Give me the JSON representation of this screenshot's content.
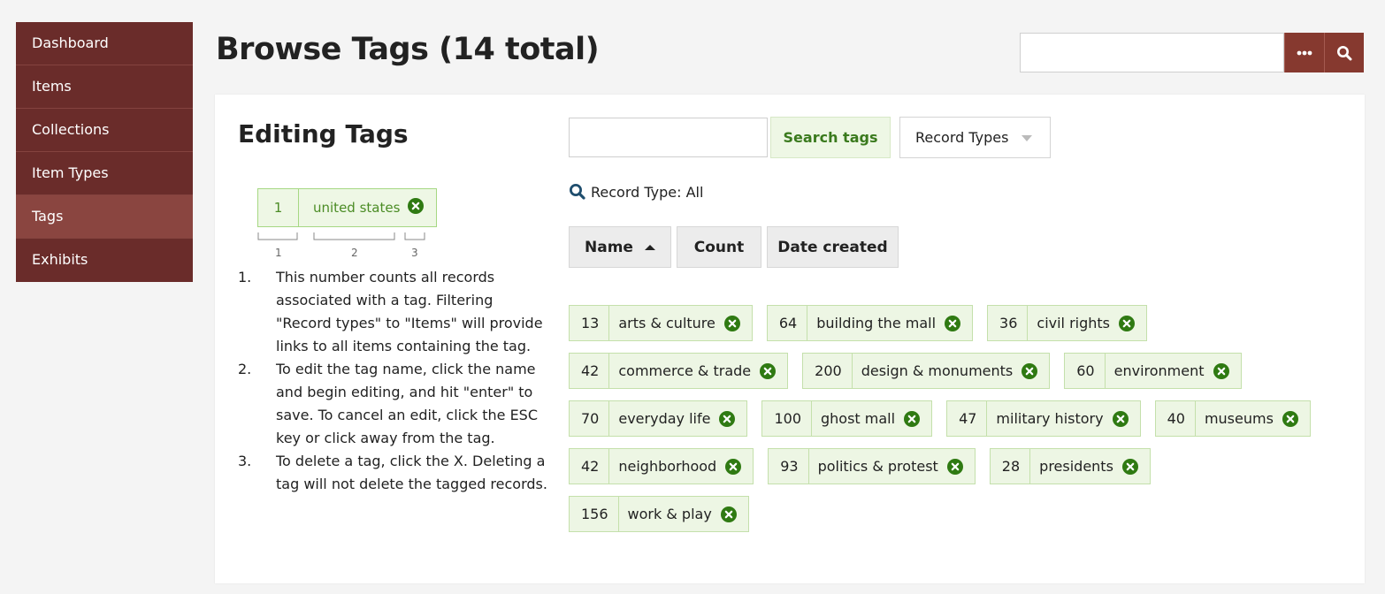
{
  "sidebar": {
    "items": [
      {
        "label": "Dashboard"
      },
      {
        "label": "Items"
      },
      {
        "label": "Collections"
      },
      {
        "label": "Item Types"
      },
      {
        "label": "Tags",
        "active": true
      },
      {
        "label": "Exhibits"
      }
    ]
  },
  "header": {
    "title": "Browse Tags (14 total)",
    "search": {
      "value": "",
      "placeholder": ""
    }
  },
  "help": {
    "title": "Editing Tags",
    "demo_tag": {
      "count": "1",
      "name": "united states"
    },
    "legend": [
      "1",
      "2",
      "3"
    ],
    "steps": [
      {
        "num": "1.",
        "text": "This number counts all records associated with a tag. Filtering \"Record types\" to \"Items\" will provide links to all items containing the tag."
      },
      {
        "num": "2.",
        "text": "To edit the tag name, click the name and begin editing, and hit \"enter\" to save. To cancel an edit, click the ESC key or click away from the tag."
      },
      {
        "num": "3.",
        "text": "To delete a tag, click the X. Deleting a tag will not delete the tagged records."
      }
    ]
  },
  "tag_search": {
    "value": "",
    "button_label": "Search tags",
    "record_types_label": "Record Types",
    "filter_text": "Record Type: All"
  },
  "sort": {
    "name_label": "Name",
    "count_label": "Count",
    "date_label": "Date created"
  },
  "tags": [
    [
      {
        "count": "13",
        "name": "arts & culture"
      },
      {
        "count": "64",
        "name": "building the mall"
      },
      {
        "count": "36",
        "name": "civil rights"
      }
    ],
    [
      {
        "count": "42",
        "name": "commerce & trade"
      },
      {
        "count": "200",
        "name": "design & monuments"
      },
      {
        "count": "60",
        "name": "environment"
      }
    ],
    [
      {
        "count": "70",
        "name": "everyday life"
      },
      {
        "count": "100",
        "name": "ghost mall"
      },
      {
        "count": "47",
        "name": "military history"
      },
      {
        "count": "40",
        "name": "museums"
      }
    ],
    [
      {
        "count": "42",
        "name": "neighborhood"
      },
      {
        "count": "93",
        "name": "politics & protest"
      },
      {
        "count": "28",
        "name": "presidents"
      }
    ],
    [
      {
        "count": "156",
        "name": "work & play"
      }
    ]
  ],
  "colors": {
    "sidebar_bg": "#6a2c2a",
    "sidebar_active": "#8a4540",
    "accent": "#86392f",
    "tag_bg": "#edf6e4",
    "tag_border": "#c4e0ab",
    "delete_icon": "#2f7a12"
  }
}
